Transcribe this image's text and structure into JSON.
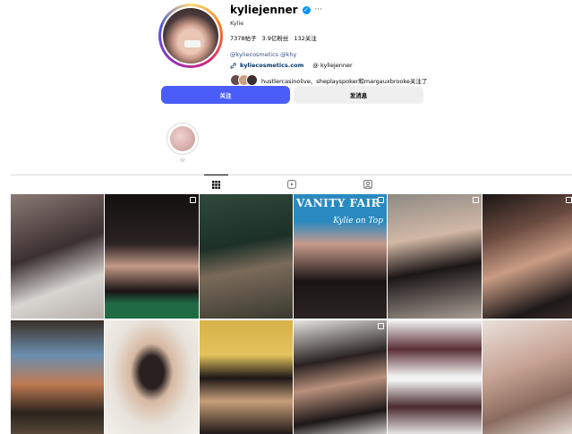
{
  "profile": {
    "username": "kyliejenner",
    "full_name": "Kylie",
    "verified_icon": "verified-badge-icon",
    "more_icon": "more-options-icon",
    "stats": {
      "posts": "7378帖子",
      "followers": "3.9亿粉丝",
      "following": "132关注"
    },
    "bio_mentions": "@kyliecosmetics @khy",
    "link": "kyliecosmetics.com",
    "link_icon": "link-icon",
    "threads_icon": "threads-icon",
    "threads_handle": "kyliejenner",
    "followed_by": "hustlercasinolive、sheplayspoker和margauxbrooke关注了"
  },
  "actions": {
    "follow_label": "关注",
    "message_label": "发消息"
  },
  "highlights": [
    {
      "label": "🤍"
    }
  ],
  "tabs": [
    {
      "name": "posts",
      "icon": "grid-icon",
      "active": true
    },
    {
      "name": "reels",
      "icon": "reels-icon",
      "active": false
    },
    {
      "name": "tagged",
      "icon": "tagged-icon",
      "active": false
    }
  ],
  "posts": {
    "cover_title": "VANITY FAIR",
    "cover_name": "Kylie on Top"
  },
  "colors": {
    "follow_button": "#4a5df9",
    "message_button": "#efefef",
    "link": "#00376b",
    "verified": "#0095f6"
  }
}
